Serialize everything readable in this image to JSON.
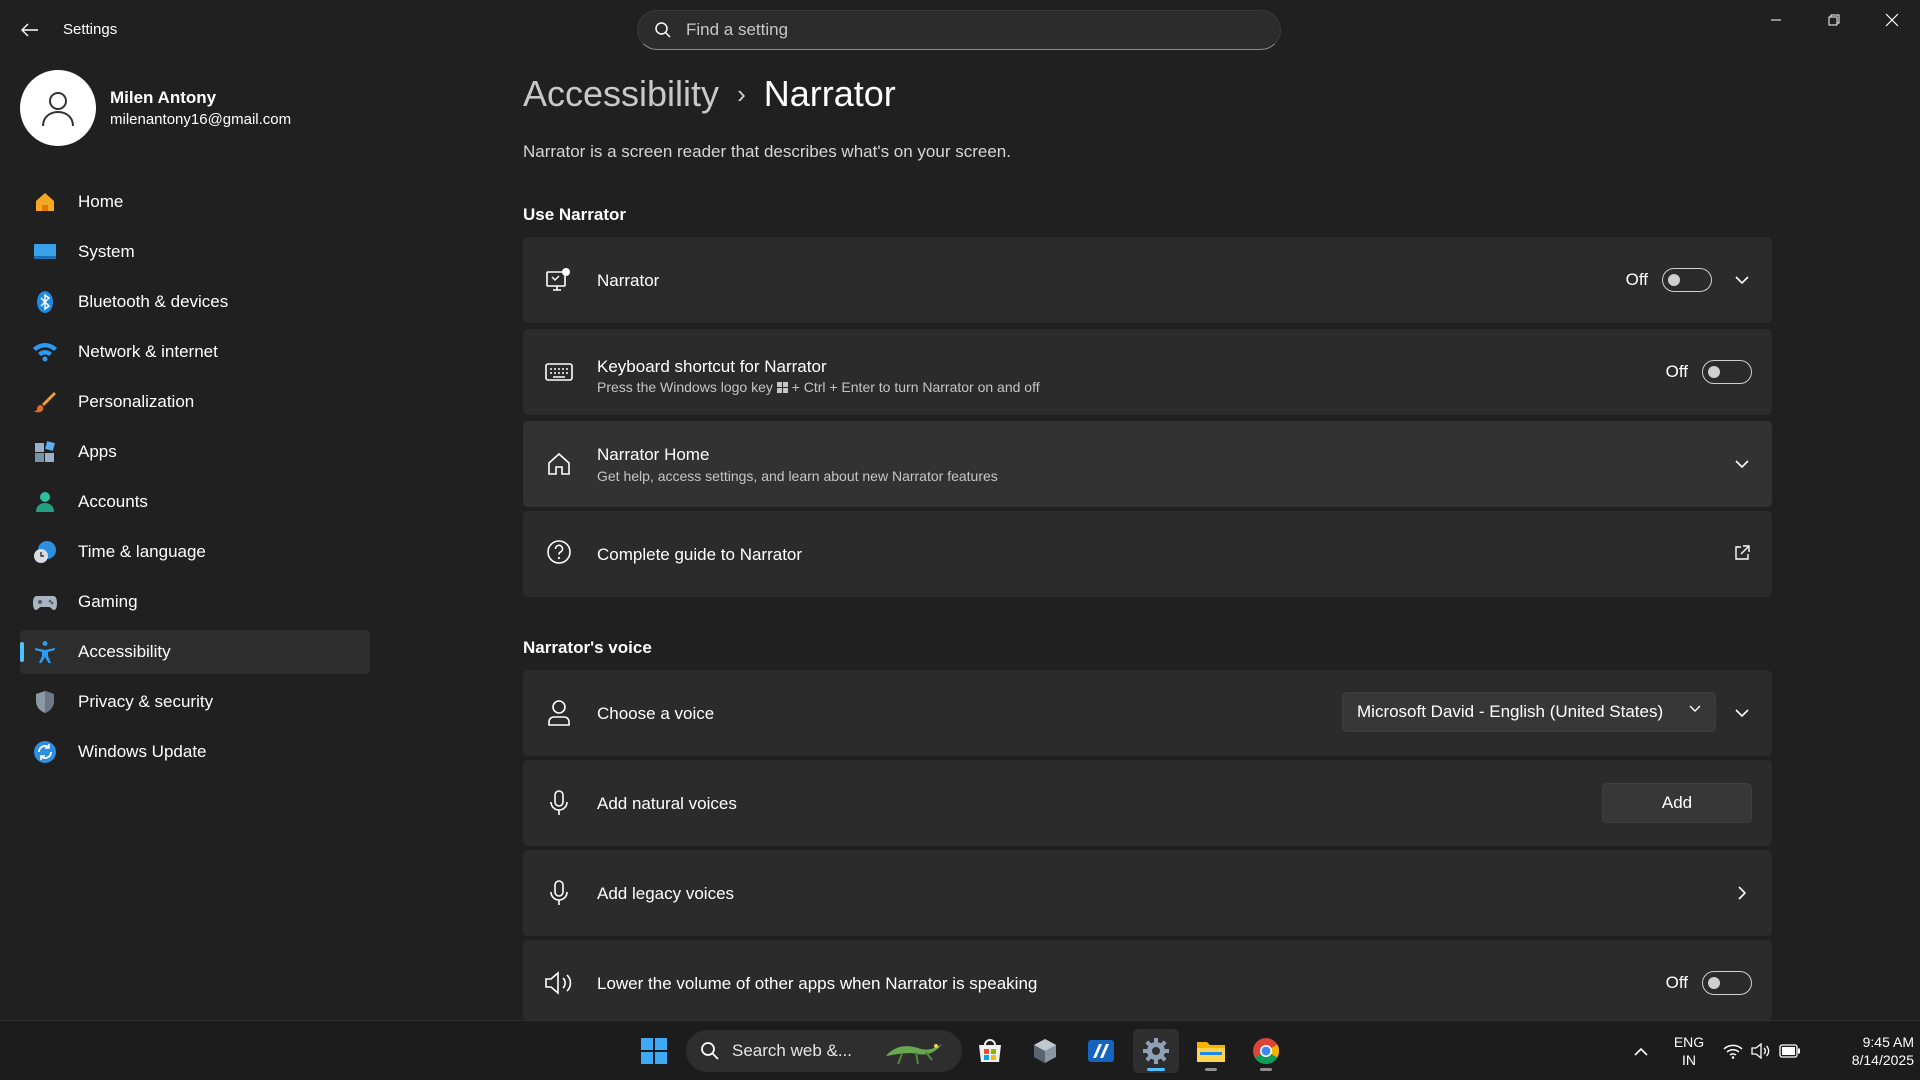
{
  "window": {
    "title": "Settings",
    "controls": [
      "minimize-icon",
      "restore-icon",
      "close-icon"
    ]
  },
  "search": {
    "placeholder": "Find a setting"
  },
  "profile": {
    "name": "Milen Antony",
    "email": "milenantony16@gmail.com"
  },
  "sidebar": {
    "items": [
      {
        "label": "Home",
        "icon": "home-icon"
      },
      {
        "label": "System",
        "icon": "system-icon"
      },
      {
        "label": "Bluetooth & devices",
        "icon": "bluetooth-icon"
      },
      {
        "label": "Network & internet",
        "icon": "wifi-icon"
      },
      {
        "label": "Personalization",
        "icon": "brush-icon"
      },
      {
        "label": "Apps",
        "icon": "apps-icon"
      },
      {
        "label": "Accounts",
        "icon": "accounts-icon"
      },
      {
        "label": "Time & language",
        "icon": "clock-globe-icon"
      },
      {
        "label": "Gaming",
        "icon": "gamepad-icon"
      },
      {
        "label": "Accessibility",
        "icon": "accessibility-icon",
        "active": true
      },
      {
        "label": "Privacy & security",
        "icon": "shield-icon"
      },
      {
        "label": "Windows Update",
        "icon": "update-icon"
      }
    ]
  },
  "breadcrumb": {
    "parent": "Accessibility",
    "separator": "›",
    "current": "Narrator"
  },
  "description": "Narrator is a screen reader that describes what's on your screen.",
  "sections": {
    "use_narrator": {
      "title": "Use Narrator",
      "narrator": {
        "title": "Narrator",
        "state": "Off"
      },
      "keyboard_shortcut": {
        "title": "Keyboard shortcut for Narrator",
        "subtitle_pre": "Press the Windows logo key",
        "subtitle_post": "+ Ctrl + Enter to turn Narrator on and off",
        "state": "Off"
      },
      "narrator_home": {
        "title": "Narrator Home",
        "subtitle": "Get help, access settings, and learn about new Narrator features"
      },
      "guide": {
        "title": "Complete guide to Narrator"
      }
    },
    "voice": {
      "title": "Narrator's voice",
      "choose_voice": {
        "title": "Choose a voice",
        "selected": "Microsoft David - English (United States)"
      },
      "natural_voices": {
        "title": "Add natural voices",
        "button": "Add"
      },
      "legacy_voices": {
        "title": "Add legacy voices"
      },
      "lower_volume": {
        "title": "Lower the volume of other apps when Narrator is speaking",
        "state": "Off"
      }
    }
  },
  "taskbar": {
    "search_label": "Search web &...",
    "language": {
      "line1": "ENG",
      "line2": "IN"
    },
    "clock": {
      "time": "9:45 AM",
      "date": "8/14/2025"
    },
    "apps": [
      "start-icon",
      "store-icon",
      "app-icon",
      "editor-icon",
      "settings-icon",
      "file-explorer-icon",
      "chrome-icon"
    ]
  },
  "colors": {
    "accent": "#4cc2ff",
    "background": "#202020",
    "card": "#2b2b2b"
  }
}
